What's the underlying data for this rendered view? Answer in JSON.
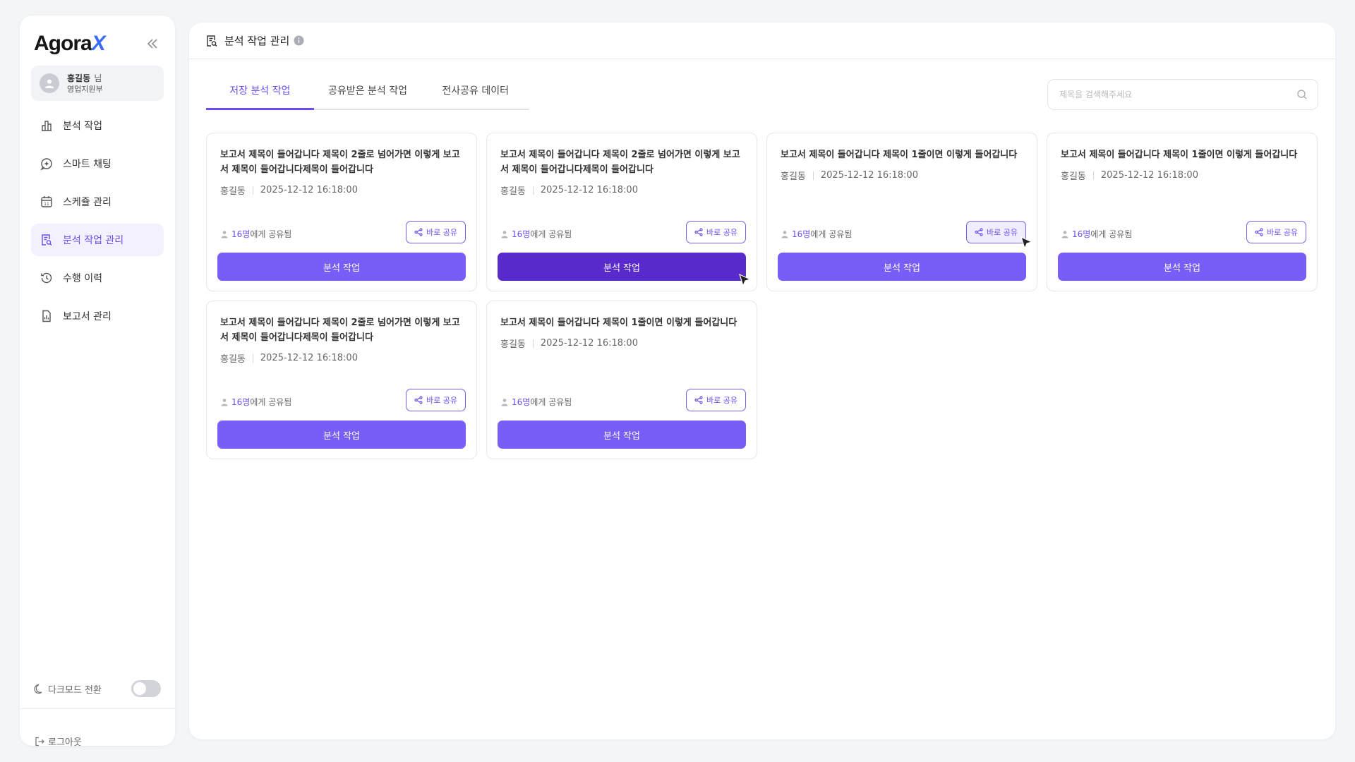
{
  "brand": {
    "logo_main": "Agora",
    "logo_accent": "X"
  },
  "user": {
    "name": "홍길동",
    "suffix": "님",
    "dept": "영업지원부"
  },
  "nav": [
    {
      "label": "분석 작업",
      "icon": "bar-chart-icon"
    },
    {
      "label": "스마트 채팅",
      "icon": "chat-sparkle-icon"
    },
    {
      "label": "스케쥴 관리",
      "icon": "calendar-icon"
    },
    {
      "label": "분석 작업 관리",
      "icon": "document-search-icon",
      "active": true
    },
    {
      "label": "수행 이력",
      "icon": "history-icon"
    },
    {
      "label": "보고서 관리",
      "icon": "report-icon"
    }
  ],
  "dark_mode": {
    "label": "다크모드 전환",
    "enabled": false
  },
  "logout": {
    "label": "로그아웃"
  },
  "header": {
    "title": "분석 작업 관리"
  },
  "tabs": [
    {
      "label": "저장 분석 작업",
      "active": true
    },
    {
      "label": "공유받은 분석 작업"
    },
    {
      "label": "전사공유 데이터"
    }
  ],
  "search": {
    "placeholder": "제목을 검색해주세요",
    "value": ""
  },
  "cards": [
    {
      "title": "보고서 제목이 들어갑니다 제목이 2줄로 넘어가면 이렇게 보고서 제목이 들어갑니다제목이 들어갑니다",
      "author": "홍길동",
      "date": "2025-12-12 16:18:00",
      "shared_count": "16명",
      "shared_suffix": "에게 공유됨",
      "share_label": "바로 공유",
      "run_label": "분석 작업"
    },
    {
      "title": "보고서 제목이 들어갑니다 제목이 2줄로 넘어가면 이렇게 보고서 제목이 들어갑니다제목이 들어갑니다",
      "author": "홍길동",
      "date": "2025-12-12 16:18:00",
      "shared_count": "16명",
      "shared_suffix": "에게 공유됨",
      "share_label": "바로 공유",
      "run_label": "분석 작업"
    },
    {
      "title": "보고서 제목이 들어갑니다 제목이 1줄이면 이렇게 들어갑니다",
      "author": "홍길동",
      "date": "2025-12-12 16:18:00",
      "shared_count": "16명",
      "shared_suffix": "에게 공유됨",
      "share_label": "바로 공유",
      "run_label": "분석 작업"
    },
    {
      "title": "보고서 제목이 들어갑니다 제목이 1줄이면 이렇게 들어갑니다",
      "author": "홍길동",
      "date": "2025-12-12 16:18:00",
      "shared_count": "16명",
      "shared_suffix": "에게 공유됨",
      "share_label": "바로 공유",
      "run_label": "분석 작업"
    },
    {
      "title": "보고서 제목이 들어갑니다 제목이 2줄로 넘어가면 이렇게 보고서 제목이 들어갑니다제목이 들어갑니다",
      "author": "홍길동",
      "date": "2025-12-12 16:18:00",
      "shared_count": "16명",
      "shared_suffix": "에게 공유됨",
      "share_label": "바로 공유",
      "run_label": "분석 작업"
    },
    {
      "title": "보고서 제목이 들어갑니다 제목이 1줄이면 이렇게 들어갑니다",
      "author": "홍길동",
      "date": "2025-12-12 16:18:00",
      "shared_count": "16명",
      "shared_suffix": "에게 공유됨",
      "share_label": "바로 공유",
      "run_label": "분석 작업"
    }
  ],
  "colors": {
    "accent": "#7a5cf6",
    "accent_pressed": "#5a2bcc",
    "background": "#f4f5f8"
  }
}
